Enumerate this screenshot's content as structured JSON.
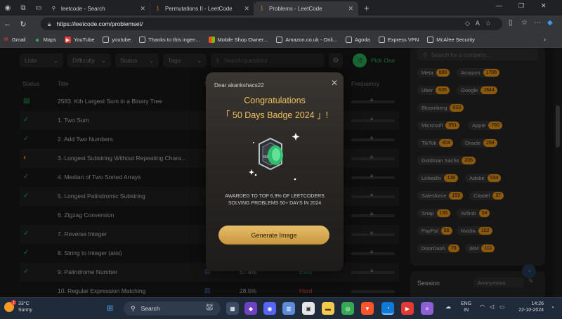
{
  "browser": {
    "tabs": [
      {
        "title": "leetcode - Search",
        "active": false
      },
      {
        "title": "Permutations II - LeetCode",
        "active": false
      },
      {
        "title": "Problems - LeetCode",
        "active": true
      }
    ],
    "url": "https://leetcode.com/problemset/",
    "bookmarks": [
      "Gmail",
      "Maps",
      "YouTube",
      "youtube",
      "Thanks to this ingen...",
      "Mobile Shop Owner...",
      "Amazon.co.uk - Onli...",
      "Agoda",
      "Express VPN",
      "McAfee Security"
    ]
  },
  "filters": {
    "lists": "Lists",
    "difficulty": "Difficulty",
    "status": "Status",
    "tags": "Tags",
    "search_placeholder": "Search questions",
    "pick_one": "Pick One"
  },
  "table": {
    "headers": {
      "status": "Status",
      "title": "Title",
      "solution": "S",
      "frequency": "Frequency"
    },
    "rows": [
      {
        "title": "2583. Kth Largest Sum in a Binary Tree",
        "acceptance": "",
        "difficulty": ""
      },
      {
        "title": "1. Two Sum",
        "acceptance": "",
        "difficulty": ""
      },
      {
        "title": "2. Add Two Numbers",
        "acceptance": "",
        "difficulty": ""
      },
      {
        "title": "3. Longest Substring Without Repeating Chara...",
        "acceptance": "",
        "difficulty": ""
      },
      {
        "title": "4. Median of Two Sorted Arrays",
        "acceptance": "",
        "difficulty": ""
      },
      {
        "title": "5. Longest Palindromic Substring",
        "acceptance": "",
        "difficulty": ""
      },
      {
        "title": "6. Zigzag Conversion",
        "acceptance": "",
        "difficulty": ""
      },
      {
        "title": "7. Reverse Integer",
        "acceptance": "",
        "difficulty": ""
      },
      {
        "title": "8. String to Integer (atoi)",
        "acceptance": "",
        "difficulty": ""
      },
      {
        "title": "9. Palindrome Number",
        "acceptance": "57.8%",
        "difficulty": "Easy"
      },
      {
        "title": "10. Regular Expression Matching",
        "acceptance": "28.5%",
        "difficulty": "Hard"
      }
    ]
  },
  "companies": {
    "search_placeholder": "Search for a company...",
    "tags": [
      {
        "name": "Meta",
        "count": "880"
      },
      {
        "name": "Amazon",
        "count": "1706"
      },
      {
        "name": "Uber",
        "count": "635"
      },
      {
        "name": "Google",
        "count": "1644"
      },
      {
        "name": "Bloomberg",
        "count": "833"
      },
      {
        "name": "Microsoft",
        "count": "951"
      },
      {
        "name": "Apple",
        "count": "760"
      },
      {
        "name": "TikTok",
        "count": "404"
      },
      {
        "name": "Oracle",
        "count": "264"
      },
      {
        "name": "Goldman Sachs",
        "count": "206"
      },
      {
        "name": "LinkedIn",
        "count": "138"
      },
      {
        "name": "Adobe",
        "count": "534"
      },
      {
        "name": "Salesforce",
        "count": "159"
      },
      {
        "name": "Citadel",
        "count": "37"
      },
      {
        "name": "Snap",
        "count": "155"
      },
      {
        "name": "Airbnb",
        "count": "54"
      },
      {
        "name": "PayPal",
        "count": "99"
      },
      {
        "name": "Nvidia",
        "count": "102"
      },
      {
        "name": "DoorDash",
        "count": "76"
      },
      {
        "name": "IBM",
        "count": "111"
      }
    ]
  },
  "session": {
    "label": "Session",
    "value": "Anonymous"
  },
  "modal": {
    "greeting": "Dear akankshacs22",
    "congrats": "Congratulations",
    "badge_title": "「 50 Days Badge 2024 」!",
    "badge_text": "365",
    "awarded_line1": "AWARDED TO TOP 6.9% OF LEETCODERS",
    "awarded_line2": "SOLVING PROBLEMS 50+ DAYS IN 2024",
    "button": "Generate Image"
  },
  "taskbar": {
    "temperature": "33°C",
    "weather": "Sunny",
    "notification_count": "1",
    "search": "Search",
    "lang1": "ENG",
    "lang2": "IN",
    "time": "14:26",
    "date": "22-10-2024"
  },
  "colors": {
    "accent": "#ffa116",
    "green": "#2cbb5d",
    "gold": "#f0c060"
  }
}
